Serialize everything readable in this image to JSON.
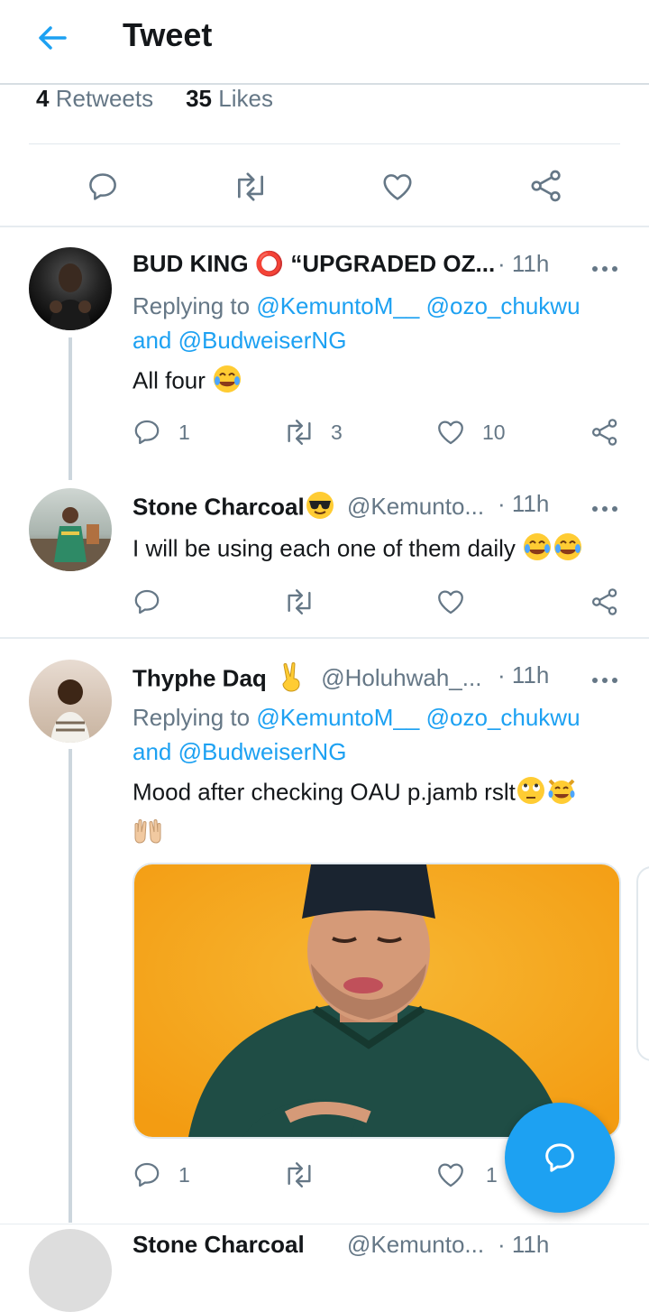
{
  "header": {
    "title": "Tweet"
  },
  "stats": {
    "retweets_count": "4",
    "retweets_label": "Retweets",
    "likes_count": "35",
    "likes_label": "Likes"
  },
  "tweets": [
    {
      "name": "BUD KING ⭕ “UPGRADED OZ...",
      "handle": "",
      "time": "· 11h",
      "replying_prefix": "Replying to",
      "replying_1": "@KemuntoM__",
      "replying_2": "@ozo_chukwu",
      "replying_and": "and",
      "replying_3": "@BudweiserNG",
      "text": "All four",
      "replies": "1",
      "retweets": "3",
      "likes": "10"
    },
    {
      "name": "Stone Charcoal",
      "handle": "@Kemunto...",
      "time": "· 11h",
      "text": "I will be using each one of them daily"
    },
    {
      "name": "Thyphe Daq",
      "handle": "@Holuhwah_...",
      "time": "· 11h",
      "replying_prefix": "Replying to",
      "replying_1": "@KemuntoM__",
      "replying_2": "@ozo_chukwu",
      "replying_and": "and",
      "replying_3": "@BudweiserNG",
      "text": "Mood after checking OAU p.jamb rslt",
      "replies": "1",
      "likes": "1"
    },
    {
      "name": "Stone Charcoal",
      "handle": "@Kemunto...",
      "time": "· 11h"
    }
  ],
  "colors": {
    "accent": "#1da1f2",
    "muted": "#657786",
    "text": "#14171a"
  },
  "icons": [
    "back-arrow-icon",
    "reply-icon",
    "retweet-icon",
    "like-icon",
    "share-icon",
    "more-icon",
    "compose-reply-icon"
  ]
}
